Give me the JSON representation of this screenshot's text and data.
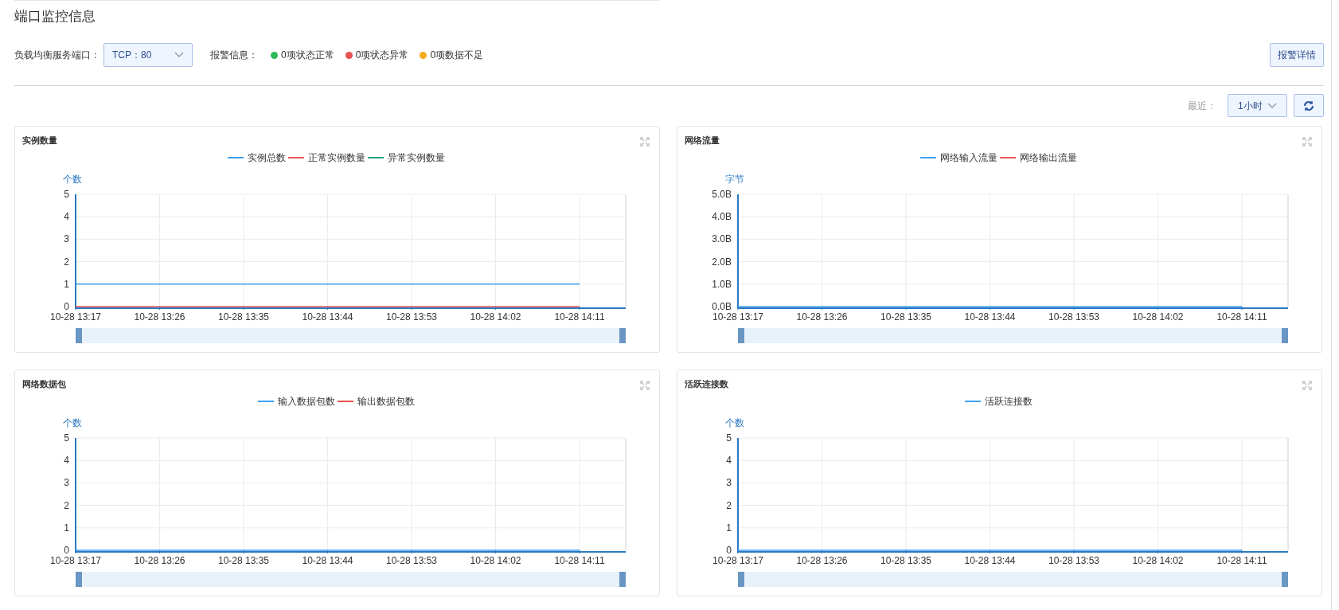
{
  "page_title": "端口监控信息",
  "filters": {
    "port_label": "负载均衡服务端口：",
    "port_value": "TCP：80",
    "alarm_label": "报警信息：",
    "alarm_items": [
      {
        "text": "0项状态正常",
        "color": "#2dbb5d"
      },
      {
        "text": "0项状态异常",
        "color": "#e9534f"
      },
      {
        "text": "0项数据不足",
        "color": "#f5ac1d"
      }
    ],
    "alarm_button": "报警详情"
  },
  "time_range": {
    "label": "最近：",
    "value": "1小时"
  },
  "charts": [
    {
      "chart_data": {
        "type": "line",
        "grid": true,
        "title": "实例数量",
        "ylabel": "个数",
        "x": [
          "10-28 13:17",
          "10-28 13:26",
          "10-28 13:35",
          "10-28 13:44",
          "10-28 13:53",
          "10-28 14:02",
          "10-28 14:11"
        ],
        "ylim": [
          0,
          5
        ],
        "yticks": [
          0,
          1,
          2,
          3,
          4,
          5
        ],
        "series": [
          {
            "name": "实例总数",
            "color": "#3fa2ef",
            "values": [
              1,
              1,
              1,
              1,
              1,
              1,
              1
            ]
          },
          {
            "name": "正常实例数量",
            "color": "#e9534f",
            "values": [
              0,
              0,
              0,
              0,
              0,
              0,
              0
            ]
          },
          {
            "name": "异常实例数量",
            "color": "#15a08a",
            "values": [
              null,
              null,
              null,
              null,
              null,
              null,
              null
            ]
          }
        ]
      }
    },
    {
      "chart_data": {
        "type": "line",
        "grid": true,
        "title": "网络流量",
        "ylabel": "字节",
        "x": [
          "10-28 13:17",
          "10-28 13:26",
          "10-28 13:35",
          "10-28 13:44",
          "10-28 13:53",
          "10-28 14:02",
          "10-28 14:11"
        ],
        "ylim": [
          0,
          5
        ],
        "yticks": [
          {
            "value": 0,
            "label": "0.0B"
          },
          {
            "value": 1,
            "label": "1.0B"
          },
          {
            "value": 2,
            "label": "2.0B"
          },
          {
            "value": 3,
            "label": "3.0B"
          },
          {
            "value": 4,
            "label": "4.0B"
          },
          {
            "value": 5,
            "label": "5.0B"
          }
        ],
        "series": [
          {
            "name": "网络输入流量",
            "color": "#3fa2ef",
            "values": [
              0,
              0,
              0,
              0,
              0,
              0,
              0
            ]
          },
          {
            "name": "网络输出流量",
            "color": "#e9534f",
            "values": [
              null,
              null,
              null,
              null,
              null,
              null,
              null
            ]
          }
        ]
      }
    },
    {
      "chart_data": {
        "type": "line",
        "grid": true,
        "title": "网络数据包",
        "ylabel": "个数",
        "x": [
          "10-28 13:17",
          "10-28 13:26",
          "10-28 13:35",
          "10-28 13:44",
          "10-28 13:53",
          "10-28 14:02",
          "10-28 14:11"
        ],
        "ylim": [
          0,
          5
        ],
        "yticks": [
          0,
          1,
          2,
          3,
          4,
          5
        ],
        "series": [
          {
            "name": "输入数据包数",
            "color": "#3fa2ef",
            "values": [
              0,
              0,
              0,
              0,
              0,
              0,
              0
            ]
          },
          {
            "name": "输出数据包数",
            "color": "#e9534f",
            "values": [
              null,
              null,
              null,
              null,
              null,
              null,
              null
            ]
          }
        ]
      }
    },
    {
      "chart_data": {
        "type": "line",
        "grid": true,
        "title": "活跃连接数",
        "ylabel": "个数",
        "x": [
          "10-28 13:17",
          "10-28 13:26",
          "10-28 13:35",
          "10-28 13:44",
          "10-28 13:53",
          "10-28 14:02",
          "10-28 14:11"
        ],
        "ylim": [
          0,
          5
        ],
        "yticks": [
          0,
          1,
          2,
          3,
          4,
          5
        ],
        "series": [
          {
            "name": "活跃连接数",
            "color": "#3fa2ef",
            "values": [
              0,
              0,
              0,
              0,
              0,
              0,
              0
            ]
          }
        ]
      }
    }
  ]
}
